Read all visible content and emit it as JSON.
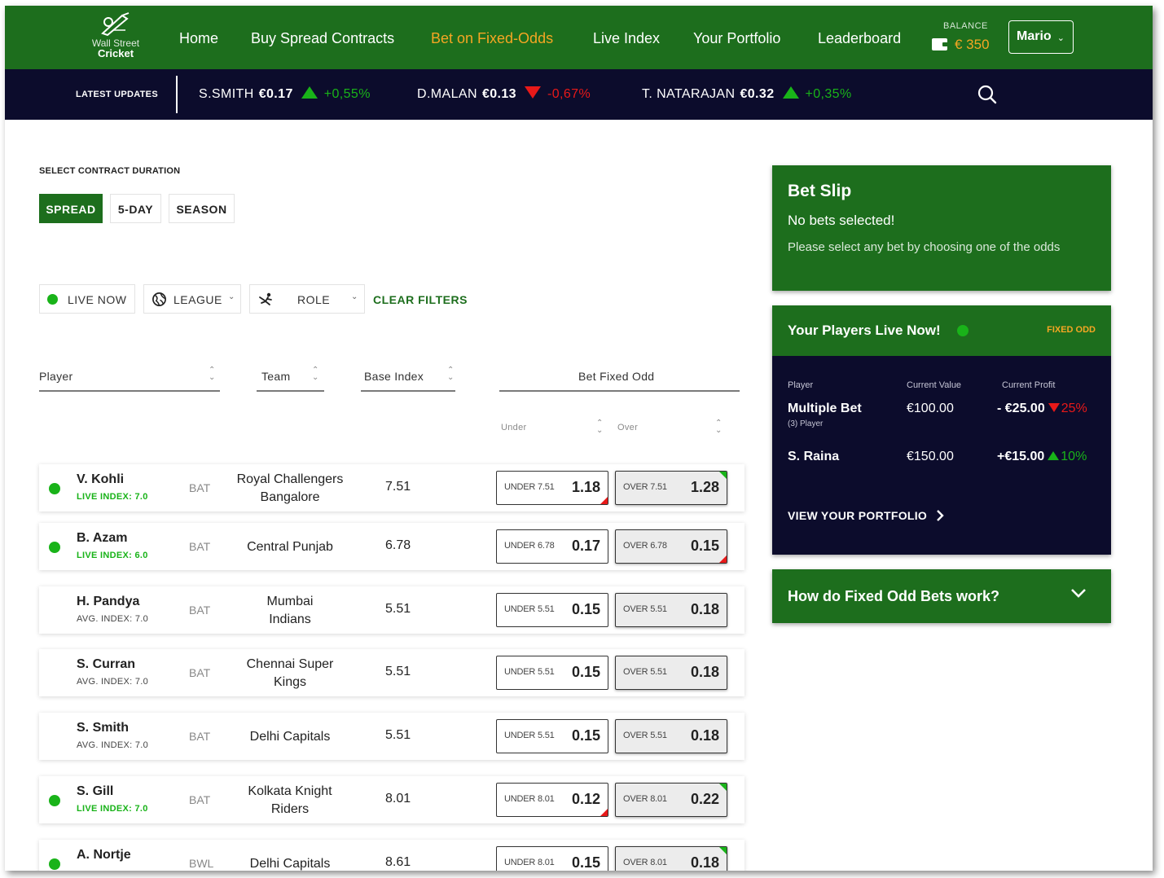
{
  "brand": {
    "line1": "Wall Street",
    "line2": "Cricket"
  },
  "nav": {
    "items": [
      {
        "label": "Home",
        "active": false
      },
      {
        "label": "Buy Spread Contracts",
        "active": false
      },
      {
        "label": "Bet on Fixed-Odds",
        "active": true
      },
      {
        "label": "Live Index",
        "active": false
      },
      {
        "label": "Your Portfolio",
        "active": false
      },
      {
        "label": "Leaderboard",
        "active": false
      }
    ],
    "balance_label": "BALANCE",
    "balance_value": "€ 350",
    "user": "Mario"
  },
  "ticker": {
    "label": "LATEST UPDATES",
    "items": [
      {
        "name": "S.SMITH",
        "price": "€0.17",
        "dir": "up",
        "change": "+0,55%"
      },
      {
        "name": "D.MALAN",
        "price": "€0.13",
        "dir": "down",
        "change": "-0,67%"
      },
      {
        "name": "T. NATARAJAN",
        "price": "€0.32",
        "dir": "up",
        "change": "+0,35%"
      }
    ]
  },
  "duration": {
    "label": "SELECT CONTRACT DURATION",
    "options": [
      "SPREAD",
      "5-DAY",
      "SEASON"
    ],
    "selected": "SPREAD"
  },
  "filters": {
    "live_now": "LIVE NOW",
    "league": "LEAGUE",
    "role": "ROLE",
    "clear": "CLEAR FILTERS"
  },
  "table": {
    "headers": {
      "player": "Player",
      "team": "Team",
      "base_index": "Base Index",
      "bet_fixed_odd": "Bet Fixed Odd",
      "under": "Under",
      "over": "Over"
    },
    "rows": [
      {
        "live": true,
        "name": "V. Kohli",
        "index": "LIVE INDEX: 7.0",
        "role": "BAT",
        "team": [
          "Royal Challengers",
          "Bangalore"
        ],
        "base": "7.51",
        "under_label": "UNDER 7.51",
        "under": "1.18",
        "under_flag": "red",
        "over_label": "OVER 7.51",
        "over": "1.28",
        "over_flag": "green"
      },
      {
        "live": true,
        "name": "B. Azam",
        "index": "LIVE INDEX: 6.0",
        "role": "BAT",
        "team": [
          "Central Punjab"
        ],
        "base": "6.78",
        "under_label": "UNDER 6.78",
        "under": "0.17",
        "under_flag": "",
        "over_label": "OVER 6.78",
        "over": "0.15",
        "over_flag": "red"
      },
      {
        "live": false,
        "name": "H. Pandya",
        "index": "AVG. INDEX: 7.0",
        "role": "BAT",
        "team": [
          "Mumbai",
          "Indians"
        ],
        "base": "5.51",
        "under_label": "UNDER 5.51",
        "under": "0.15",
        "under_flag": "",
        "over_label": "OVER 5.51",
        "over": "0.18",
        "over_flag": ""
      },
      {
        "live": false,
        "name": "S. Curran",
        "index": "AVG. INDEX: 7.0",
        "role": "BAT",
        "team": [
          "Chennai Super",
          "Kings"
        ],
        "base": "5.51",
        "under_label": "UNDER 5.51",
        "under": "0.15",
        "under_flag": "",
        "over_label": "OVER 5.51",
        "over": "0.18",
        "over_flag": ""
      },
      {
        "live": false,
        "name": "S. Smith",
        "index": "AVG. INDEX: 7.0",
        "role": "BAT",
        "team": [
          "Delhi Capitals"
        ],
        "base": "5.51",
        "under_label": "UNDER 5.51",
        "under": "0.15",
        "under_flag": "",
        "over_label": "OVER 5.51",
        "over": "0.18",
        "over_flag": ""
      },
      {
        "live": true,
        "name": "S. Gill",
        "index": "LIVE INDEX: 7.0",
        "role": "BAT",
        "team": [
          "Kolkata Knight",
          "Riders"
        ],
        "base": "8.01",
        "under_label": "UNDER 8.01",
        "under": "0.12",
        "under_flag": "red",
        "over_label": "OVER 8.01",
        "over": "0.22",
        "over_flag": "green"
      },
      {
        "live": true,
        "name": "A. Nortje",
        "index": "",
        "role": "BWL",
        "team": [
          "Delhi Capitals"
        ],
        "base": "8.61",
        "under_label": "UNDER 8.01",
        "under": "0.15",
        "under_flag": "",
        "over_label": "OVER 8.01",
        "over": "0.18",
        "over_flag": "green"
      }
    ]
  },
  "bet_slip": {
    "title": "Bet Slip",
    "status": "No bets selected!",
    "hint": "Please select any bet by choosing one of the odds"
  },
  "players_live": {
    "title": "Your Players Live Now!",
    "tag": "FIXED ODD",
    "headers": {
      "player": "Player",
      "current_value": "Current Value",
      "current_profit": "Current Profit"
    },
    "rows": [
      {
        "name": "Multiple Bet",
        "sub": "(3) Player",
        "value": "€100.00",
        "profit": "- €25.00",
        "dir": "down",
        "pct": "25%"
      },
      {
        "name": "S. Raina",
        "sub": "",
        "value": "€150.00",
        "profit": "+€15.00",
        "dir": "up",
        "pct": "10%"
      }
    ],
    "cta": "VIEW YOUR PORTFOLIO"
  },
  "faq": {
    "title": "How do Fixed Odd Bets work?"
  },
  "colors": {
    "brand_green": "#1d6e1d",
    "navy": "#0c0c2c",
    "accent_orange": "#f5a623",
    "up_green": "#19b319",
    "down_red": "#e81919"
  }
}
